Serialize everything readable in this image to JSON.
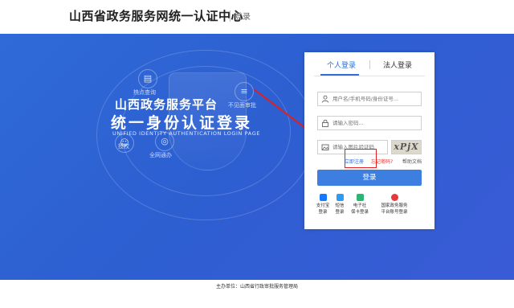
{
  "header": {
    "title": "山西省政务服务网统一认证中心",
    "subtitle": "登录"
  },
  "banner": {
    "slogan_line1": "山西政务服务平台",
    "slogan_line2": "统一身份认证登录",
    "slogan_line3": "UNIFIED IDENTITY AUTHENTICATION LOGIN PAGE",
    "deco_labels": [
      "热点查询",
      "不见面审批",
      "全网通办",
      "授权"
    ]
  },
  "login": {
    "tabs": [
      {
        "label": "个人登录"
      },
      {
        "label": "法人登录"
      }
    ],
    "username_placeholder": "用户名/手机号码/身份证号...",
    "password_placeholder": "请输入密码...",
    "captcha_placeholder": "请输入图片验证码",
    "captcha_text": "xPjX",
    "register_link": "立即注册",
    "forgot_link": "忘记密码?",
    "help_link": "帮助文档",
    "login_button": "登录",
    "alt_logins": [
      {
        "line1": "支付宝",
        "line2": "登录",
        "color": "#1677ff"
      },
      {
        "line1": "短信",
        "line2": "登录",
        "color": "#2f9bf0"
      },
      {
        "line1": "电子社",
        "line2": "保卡登录",
        "color": "#2bb673"
      },
      {
        "line1": "国家政务服务",
        "line2": "平台账号登录",
        "color": "#e8393a"
      }
    ]
  },
  "footer": {
    "text": "主办单位：山西省行政审批服务管理局"
  },
  "colors": {
    "accent": "#2f6fd6",
    "banner": "#2f62d4",
    "highlight": "#e02020"
  }
}
